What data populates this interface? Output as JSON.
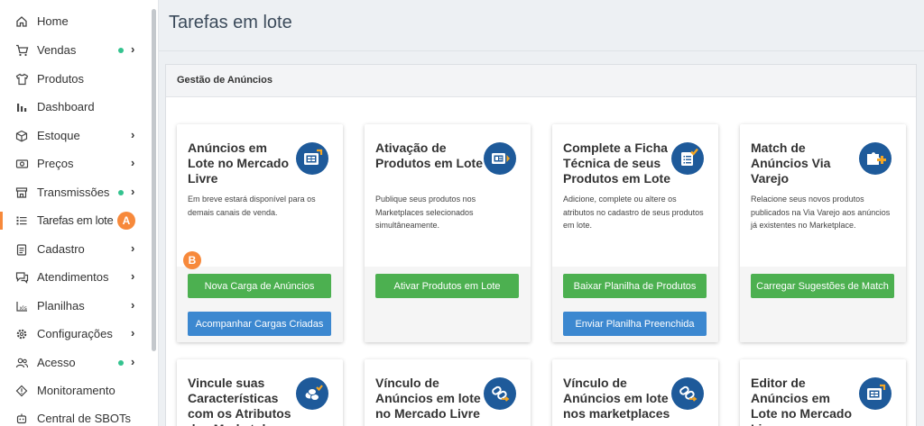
{
  "sidebar": {
    "items": [
      {
        "label": "Home",
        "icon": "home-icon",
        "dot": false,
        "chevron": false
      },
      {
        "label": "Vendas",
        "icon": "cart-icon",
        "dot": true,
        "chevron": true
      },
      {
        "label": "Produtos",
        "icon": "shirt-icon",
        "dot": false,
        "chevron": false
      },
      {
        "label": "Dashboard",
        "icon": "bar-chart-icon",
        "dot": false,
        "chevron": false
      },
      {
        "label": "Estoque",
        "icon": "box-icon",
        "dot": false,
        "chevron": true
      },
      {
        "label": "Preços",
        "icon": "money-icon",
        "dot": false,
        "chevron": true
      },
      {
        "label": "Transmissões",
        "icon": "store-icon",
        "dot": true,
        "chevron": true
      },
      {
        "label": "Tarefas em lote",
        "icon": "list-icon",
        "dot": false,
        "chevron": false,
        "active": true
      },
      {
        "label": "Cadastro",
        "icon": "clipboard-icon",
        "dot": false,
        "chevron": true
      },
      {
        "label": "Atendimentos",
        "icon": "chat-icon",
        "dot": false,
        "chevron": true
      },
      {
        "label": "Planilhas",
        "icon": "spreadsheet-icon",
        "dot": false,
        "chevron": true
      },
      {
        "label": "Configurações",
        "icon": "gear-icon",
        "dot": false,
        "chevron": true
      },
      {
        "label": "Acesso",
        "icon": "users-icon",
        "dot": true,
        "chevron": true
      },
      {
        "label": "Monitoramento",
        "icon": "diamond-icon",
        "dot": false,
        "chevron": false
      },
      {
        "label": "Central de SBOTs",
        "icon": "robot-icon",
        "dot": false,
        "chevron": false
      }
    ],
    "chevron_glyph": "›"
  },
  "markers": {
    "a": "A",
    "b": "B"
  },
  "page": {
    "title": "Tarefas em lote"
  },
  "panel": {
    "title": "Gestão de Anúncios"
  },
  "cards": [
    {
      "title": "Anúncios em Lote no Mercado Livre",
      "description": "Em breve estará disponível para os demais canais de venda.",
      "icon": "batch-listing-icon",
      "buttons": [
        "Nova Carga de Anúncios",
        "Acompanhar Cargas Criadas"
      ]
    },
    {
      "title": "Ativação de Produtos em Lote",
      "description": "Publique seus produtos nos Marketplaces selecionados simultâneamente.",
      "icon": "activate-products-icon",
      "buttons": [
        "Ativar Produtos em Lote"
      ]
    },
    {
      "title": "Complete a Ficha Técnica de seus Produtos em Lote",
      "description": "Adicione, complete ou altere os atributos no cadastro de seus produtos em lote.",
      "icon": "checklist-icon",
      "buttons": [
        "Baixar Planilha de Produtos",
        "Enviar Planilha Preenchida"
      ]
    },
    {
      "title": "Match de Anúncios Via Varejo",
      "description": "Relacione seus novos produtos publicados na Via Varejo aos anúncios já existentes no Marketplace.",
      "icon": "puzzle-icon",
      "buttons": [
        "Carregar Sugestões de Match"
      ]
    }
  ],
  "cards_row2": [
    {
      "title": "Vincule suas Características com os Atributos dos Marketplaces",
      "icon": "coins-icon"
    },
    {
      "title": "Vínculo de Anúncios em lote no Mercado Livre",
      "icon": "link-icon"
    },
    {
      "title": "Vínculo de Anúncios em lote nos marketplaces",
      "icon": "link-icon"
    },
    {
      "title": "Editor de Anúncios em Lote no Mercado Livre",
      "icon": "batch-listing-icon"
    }
  ],
  "colors": {
    "accent": "#f7893b",
    "green": "#4cb050",
    "blue": "#3c88d0",
    "icon_bg": "#1e5a9a",
    "status_dot": "#34c38f"
  }
}
